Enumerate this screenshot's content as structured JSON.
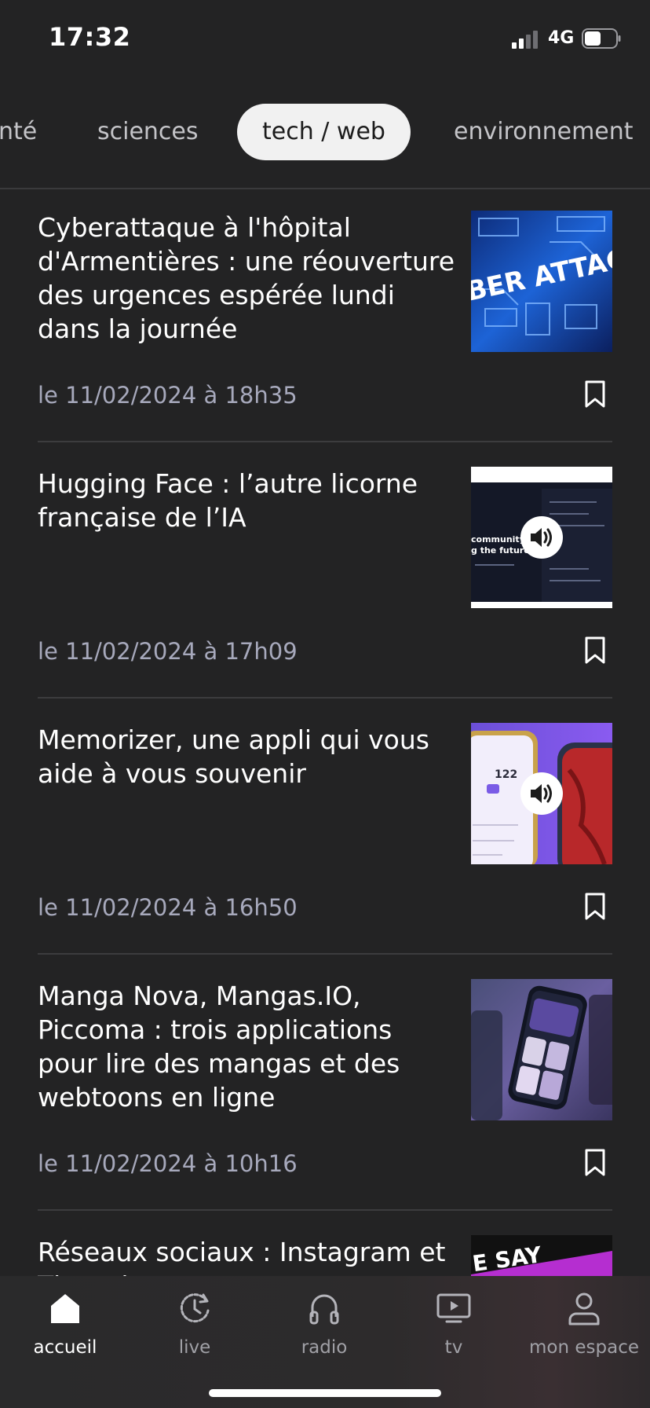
{
  "status_bar": {
    "time": "17:32",
    "network": "4G"
  },
  "categories": {
    "items": [
      {
        "label": "nté"
      },
      {
        "label": "sciences"
      },
      {
        "label": "tech / web"
      },
      {
        "label": "environnement"
      }
    ],
    "active_index": 2
  },
  "articles": [
    {
      "title": "Cyberattaque à l'hôpital d'Armentières : une réouverture des urgences espérée lundi dans la journée",
      "date": "le 11/02/2024 à 18h35",
      "thumbnail": {
        "has_audio": false,
        "overlay_text": "BER ATTACK"
      }
    },
    {
      "title": "Hugging Face : l’autre licorne française de l’IA",
      "date": "le 11/02/2024 à 17h09",
      "thumbnail": {
        "has_audio": true,
        "overlay_text": "community g the future."
      }
    },
    {
      "title": "Memorizer, une appli qui vous aide à vous souvenir",
      "date": "le 11/02/2024 à 16h50",
      "thumbnail": {
        "has_audio": true,
        "overlay_text": "122"
      }
    },
    {
      "title": "Manga Nova, Mangas.IO, Piccoma : trois applications pour lire des mangas et des webtoons en ligne",
      "date": "le 11/02/2024 à 10h16",
      "thumbnail": {
        "has_audio": false
      }
    },
    {
      "title": "Réseaux sociaux : Instagram et Threads...",
      "date": "",
      "thumbnail": {
        "has_audio": false,
        "overlay_text": "E SAY"
      }
    }
  ],
  "bottom_nav": {
    "items": [
      {
        "label": "accueil",
        "icon": "home-icon",
        "active": true
      },
      {
        "label": "live",
        "icon": "clock-icon",
        "active": false
      },
      {
        "label": "radio",
        "icon": "headphones-icon",
        "active": false
      },
      {
        "label": "tv",
        "icon": "tv-icon",
        "active": false
      },
      {
        "label": "mon espace",
        "icon": "user-icon",
        "active": false
      }
    ]
  },
  "colors": {
    "background": "#232324",
    "date_text": "#a7a9bc",
    "active_tab_bg": "#f1f1f1"
  }
}
